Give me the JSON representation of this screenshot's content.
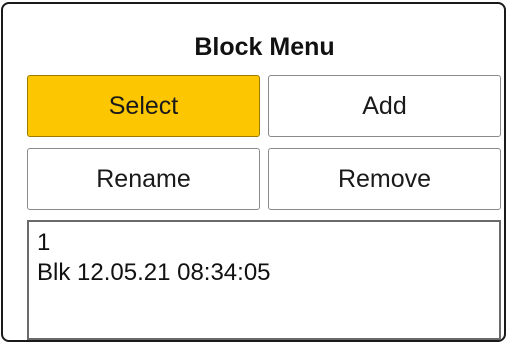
{
  "menu": {
    "title": "Block Menu"
  },
  "buttons": {
    "select": "Select",
    "add": "Add",
    "rename": "Rename",
    "remove": "Remove"
  },
  "colors": {
    "active_button": "#fcc600",
    "border": "#1a1a1a"
  },
  "block_list": {
    "items": [
      {
        "number": "1",
        "name": "Blk 12.05.21 08:34:05"
      }
    ]
  }
}
